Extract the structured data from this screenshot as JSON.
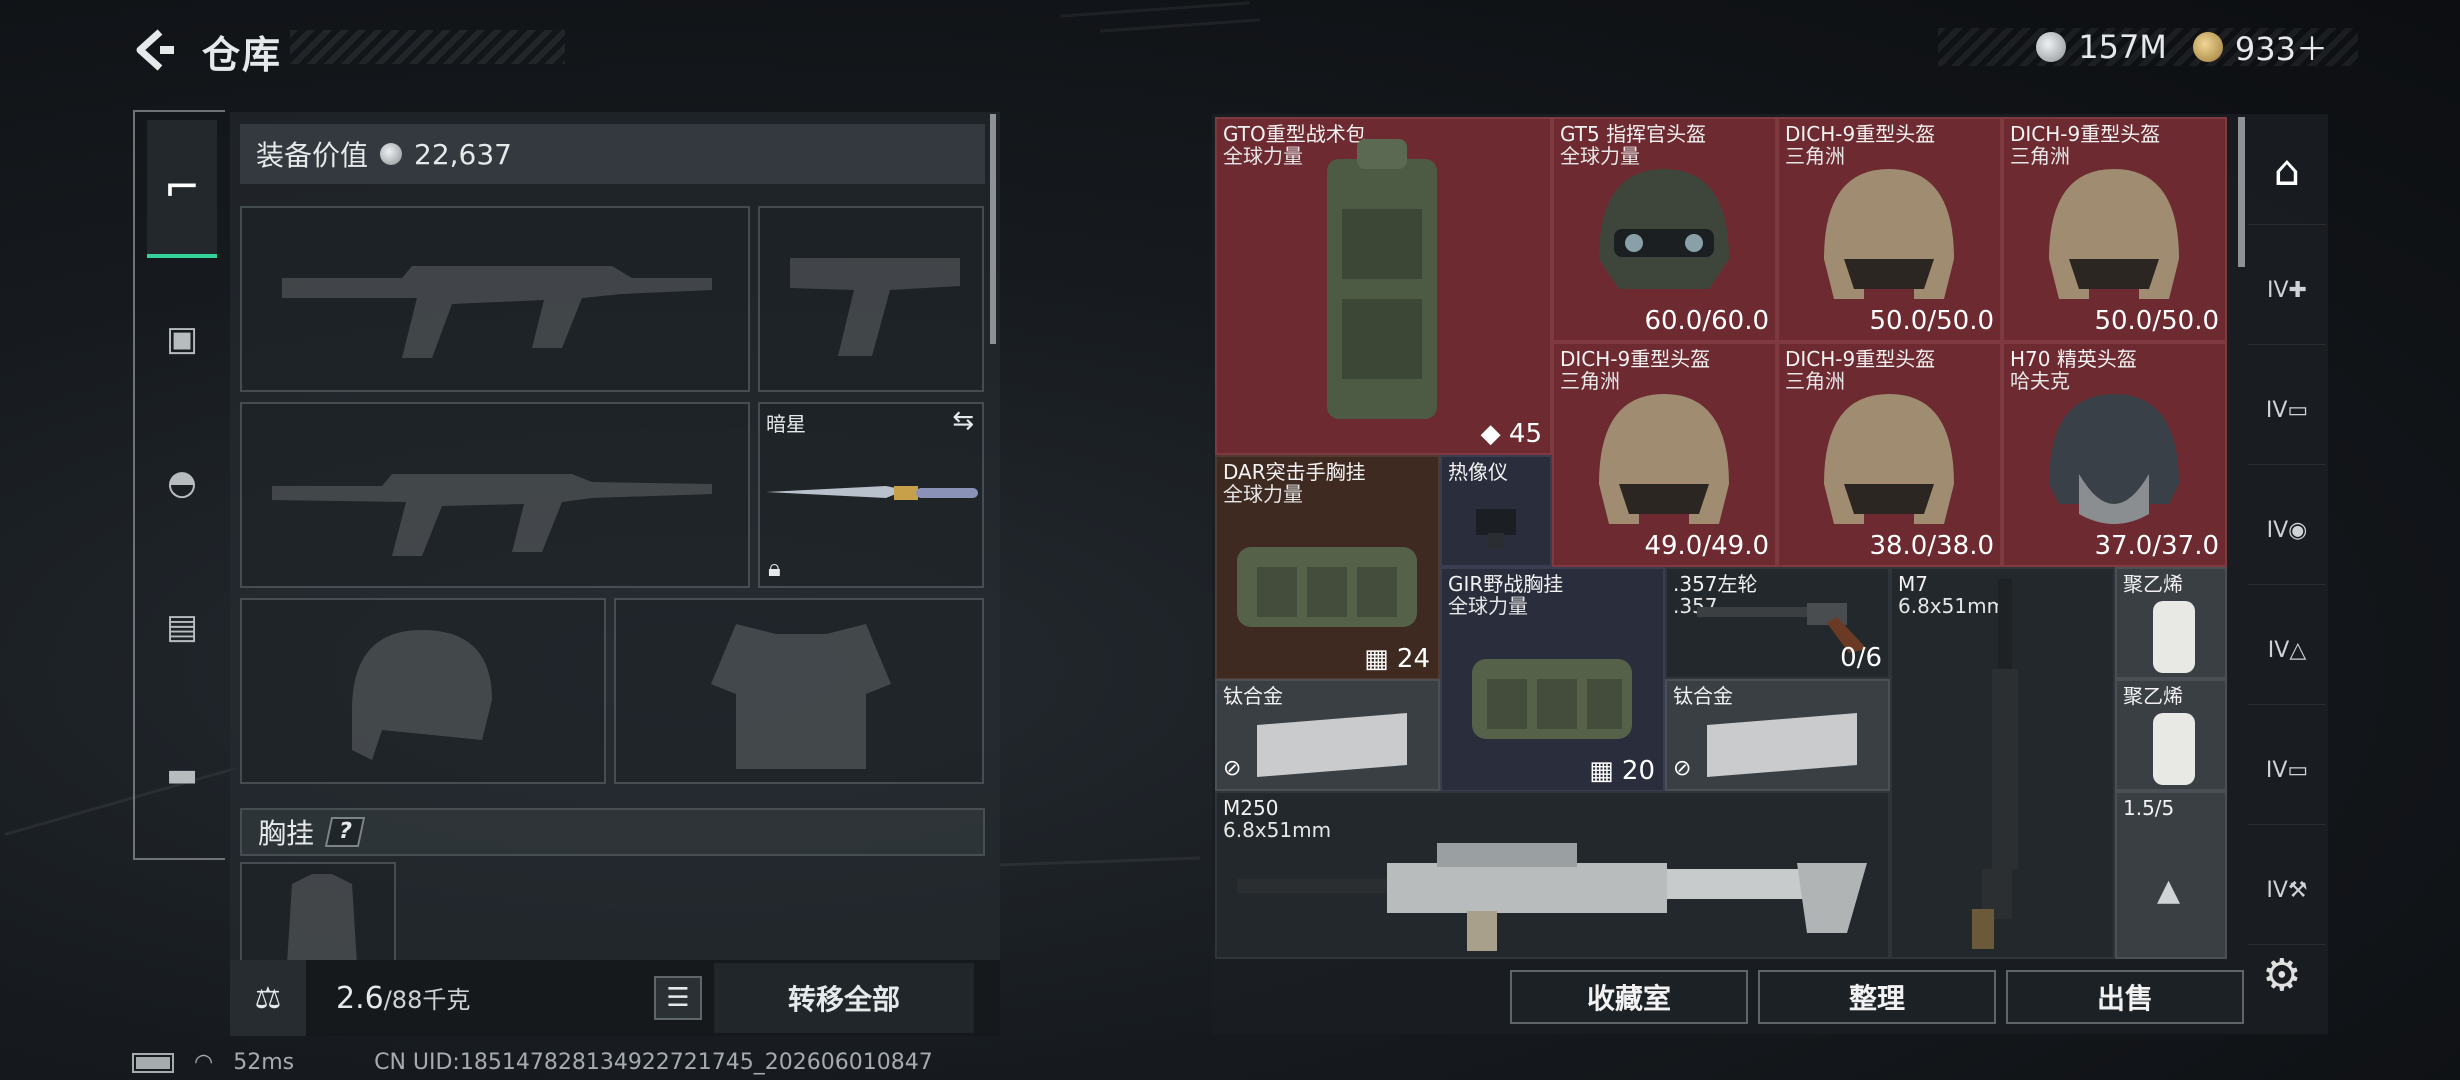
{
  "header": {
    "title": "仓库",
    "back_icon": "back-arrow-icon"
  },
  "currency": [
    {
      "icon": "silver-coin-icon",
      "value": "157M",
      "color": "#c9ced1"
    },
    {
      "icon": "gold-triangle-coin-icon",
      "value": "933＋",
      "color": "#c7a35a"
    }
  ],
  "left": {
    "nav": [
      {
        "icon": "pistol-icon",
        "active": true
      },
      {
        "icon": "backpack-icon"
      },
      {
        "icon": "helmet-icon"
      },
      {
        "icon": "vest-icon"
      },
      {
        "icon": "toolbox-icon"
      }
    ],
    "equipment_value_label": "装备价值",
    "equipment_value": "22,637",
    "melee": {
      "name": "暗星",
      "swap_icon": "swap-icon",
      "lock_icon": "lock-icon"
    },
    "chest_rig_label": "胸挂",
    "help": "?",
    "weight": "2.6",
    "weight_cap": "/88千克",
    "transfer_all": "转移全部",
    "kg_icon": "weight-icon",
    "list_icon": "list-icon"
  },
  "grid": {
    "items": [
      {
        "name": "GTO重型战术包",
        "sub": "全球力量",
        "count": "45",
        "color": "red"
      },
      {
        "name": "GT5 指挥官头盔",
        "sub": "全球力量",
        "durability": "60.0/60.0",
        "color": "red"
      },
      {
        "name": "DICH-9重型头盔",
        "sub": "三角洲",
        "durability": "50.0/50.0",
        "color": "red"
      },
      {
        "name": "DICH-9重型头盔",
        "sub": "三角洲",
        "durability": "50.0/50.0",
        "color": "red"
      },
      {
        "name": "DICH-9重型头盔",
        "sub": "三角洲",
        "durability": "49.0/49.0",
        "color": "red"
      },
      {
        "name": "DICH-9重型头盔",
        "sub": "三角洲",
        "durability": "38.0/38.0",
        "color": "red"
      },
      {
        "name": "H70 精英头盔",
        "sub": "哈夫克",
        "durability": "37.0/37.0",
        "color": "red"
      },
      {
        "name": "DAR突击手胸挂",
        "sub": "全球力量",
        "count": "24",
        "color": "brown"
      },
      {
        "name": "热像仪",
        "color": "navy"
      },
      {
        "name": "GIR野战胸挂",
        "sub": "全球力量",
        "count": "20",
        "color": "navy"
      },
      {
        "name": ".357左轮",
        "sub": ".357",
        "ammo": "0/6",
        "color": "dark"
      },
      {
        "name": "M7",
        "sub": "6.8x51mm",
        "color": "dark"
      },
      {
        "name": "聚乙烯",
        "color": "gray"
      },
      {
        "name": "钛合金",
        "color": "gray"
      },
      {
        "name": "钛合金",
        "color": "gray"
      },
      {
        "name": "聚乙烯",
        "color": "gray"
      },
      {
        "name": "M250",
        "sub": "6.8x51mm",
        "color": "dark"
      },
      {
        "name": "1.5/5",
        "color": "gray"
      }
    ]
  },
  "right_nav": [
    {
      "icon": "safe-box-icon"
    },
    {
      "label": "IV",
      "icon": "medkit-icon"
    },
    {
      "label": "IV",
      "icon": "folder-icon"
    },
    {
      "label": "IV",
      "icon": "ammo-box-icon"
    },
    {
      "label": "IV",
      "icon": "equipment-icon"
    },
    {
      "label": "IV",
      "icon": "folder-icon"
    },
    {
      "label": "IV",
      "icon": "tools-icon"
    }
  ],
  "actions": {
    "collection": "收藏室",
    "sort": "整理",
    "sell": "出售"
  },
  "status": {
    "ping": "52ms",
    "uid": "CN UID:18514782813492272174​5_202606010847"
  }
}
